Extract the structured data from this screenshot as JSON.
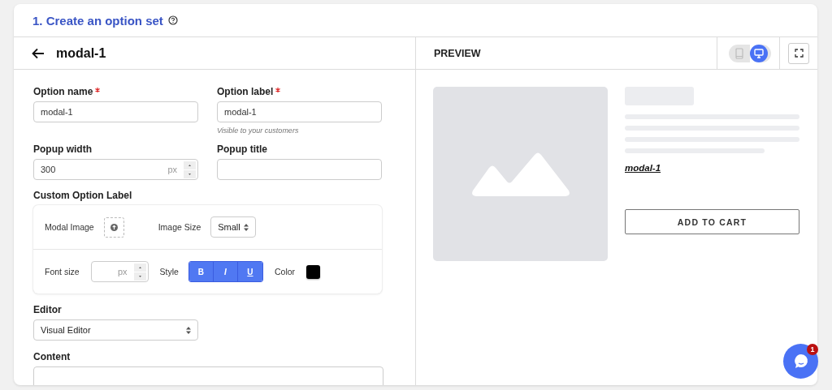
{
  "section": {
    "title": "1. Create an option set"
  },
  "editor": {
    "title": "modal-1",
    "option_name": {
      "label": "Option name",
      "required": true,
      "value": "modal-1"
    },
    "option_label": {
      "label": "Option label",
      "required": true,
      "value": "modal-1",
      "help": "Visible to your customers"
    },
    "popup_width": {
      "label": "Popup width",
      "value": "300",
      "unit": "px"
    },
    "popup_title": {
      "label": "Popup title"
    },
    "custom_label": {
      "label": "Custom Option Label",
      "modal_image_label": "Modal Image",
      "image_size_label": "Image Size",
      "image_size": "Small",
      "font_size_label": "Font size",
      "font_size_unit": "px",
      "style_label": "Style",
      "styles": [
        {
          "label": "B",
          "kind": "bold",
          "selected": true
        },
        {
          "label": "I",
          "kind": "italic",
          "selected": true
        },
        {
          "label": "U",
          "kind": "underline",
          "selected": true
        }
      ],
      "color_label": "Color",
      "color": "#000000"
    },
    "editor_select": {
      "label": "Editor",
      "value": "Visual Editor"
    },
    "content": {
      "label": "Content"
    }
  },
  "preview": {
    "title": "PREVIEW",
    "devices": [
      {
        "kind": "mobile",
        "selected": false
      },
      {
        "kind": "desktop",
        "selected": true
      }
    ],
    "option_link": "modal-1",
    "button": "ADD TO CART"
  },
  "chat": {
    "badge": "1"
  }
}
